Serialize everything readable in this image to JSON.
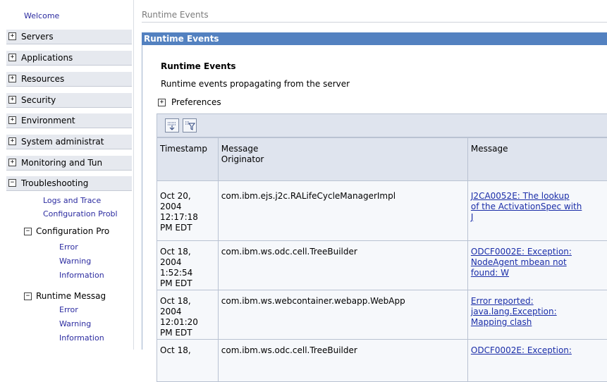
{
  "sidebar": {
    "welcome": "Welcome",
    "items": [
      {
        "label": "Servers",
        "expanded": false
      },
      {
        "label": "Applications",
        "expanded": false
      },
      {
        "label": "Resources",
        "expanded": false
      },
      {
        "label": "Security",
        "expanded": false
      },
      {
        "label": "Environment",
        "expanded": false
      },
      {
        "label": "System administrat",
        "expanded": false
      },
      {
        "label": "Monitoring and Tun",
        "expanded": false
      },
      {
        "label": "Troubleshooting",
        "expanded": true
      }
    ],
    "troubleshooting": {
      "logs_and_trace": "Logs and Trace",
      "configuration_problems": "Configuration Probl",
      "config_group": {
        "label": "Configuration Pro",
        "items": [
          "Error",
          "Warning",
          "Information"
        ]
      },
      "runtime_group": {
        "label": "Runtime Messag",
        "items": [
          "Error",
          "Warning",
          "Information"
        ]
      }
    },
    "expand_glyph": "+",
    "collapse_glyph": "−"
  },
  "breadcrumb": "Runtime Events",
  "panel": {
    "title": "Runtime Events",
    "section_title": "Runtime Events",
    "description": "Runtime events propagating from the server",
    "preferences": "Preferences"
  },
  "table": {
    "headers": {
      "timestamp": "Timestamp",
      "originator_line1": "Message",
      "originator_line2": "Originator",
      "message": "Message"
    },
    "rows": [
      {
        "ts": [
          "Oct 20,",
          "2004",
          "12:17:18",
          "PM EDT"
        ],
        "originator": "com.ibm.ejs.j2c.RALifeCycleManagerImpl",
        "message": [
          "J2CA0052E: The lookup",
          "of the ActivationSpec with",
          "J"
        ]
      },
      {
        "ts": [
          "Oct 18,",
          "2004",
          "1:52:54",
          "PM EDT"
        ],
        "originator": "com.ibm.ws.odc.cell.TreeBuilder",
        "message": [
          "ODCF0002E: Exception:",
          "NodeAgent mbean not",
          "found: W"
        ]
      },
      {
        "ts": [
          "Oct 18,",
          "2004",
          "12:01:20",
          "PM EDT"
        ],
        "originator": "com.ibm.ws.webcontainer.webapp.WebApp",
        "message": [
          "Error reported:",
          "java.lang.Exception:",
          "Mapping clash"
        ]
      },
      {
        "ts": [
          "Oct 18,",
          "",
          "",
          ""
        ],
        "originator": "com.ibm.ws.odc.cell.TreeBuilder",
        "message": [
          "ODCF0002E: Exception:",
          "",
          ""
        ]
      }
    ]
  },
  "colors": {
    "titlebar": "#5381c0",
    "nav_bg": "#e6e9ef",
    "link": "#1a2da8",
    "table_header": "#dfe4ee"
  }
}
